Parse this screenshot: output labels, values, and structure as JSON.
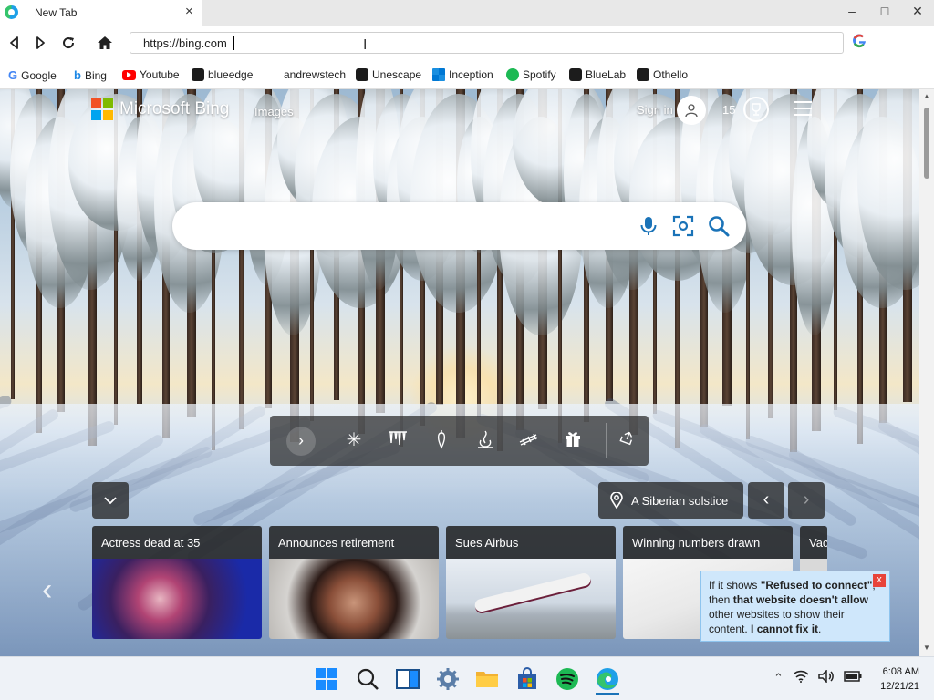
{
  "browser": {
    "tab_title": "New Tab",
    "address_url": "https://bing.com",
    "bookmarks": [
      {
        "label": "Google",
        "icon": "google-icon",
        "color": "#4285f4"
      },
      {
        "label": "Bing",
        "icon": "bing-icon",
        "color": "#1e88e5"
      },
      {
        "label": "Youtube",
        "icon": "youtube-icon",
        "color": "#ff0000"
      },
      {
        "label": "blueedge",
        "icon": "react-icon",
        "color": "#1c1c1c"
      },
      {
        "label": "andrewstech",
        "icon": "",
        "color": ""
      },
      {
        "label": "Unescape",
        "icon": "react-icon",
        "color": "#1c1c1c"
      },
      {
        "label": "Inception",
        "icon": "windows-icon",
        "color": "#0078d4"
      },
      {
        "label": "Spotify",
        "icon": "spotify-icon",
        "color": "#1db954"
      },
      {
        "label": "BlueLab",
        "icon": "react-icon",
        "color": "#1c1c1c"
      },
      {
        "label": "Othello",
        "icon": "react-icon",
        "color": "#1c1c1c"
      }
    ]
  },
  "bing": {
    "logo_text": "Microsoft Bing",
    "nav_images": "Images",
    "sign_in": "Sign in",
    "points": "15",
    "caption": "A Siberian solstice",
    "news": [
      {
        "title": "Actress dead at 35"
      },
      {
        "title": "Announces retirement"
      },
      {
        "title": "Sues Airbus"
      },
      {
        "title": "Winning numbers drawn"
      },
      {
        "title": "Vac"
      }
    ]
  },
  "tooltip": {
    "line1_prefix": "If it shows ",
    "line1_bold": "\"Refused to connect\"",
    "line1_suffix": ",",
    "line2_prefix": "then ",
    "line2_bold": "that website doesn't allow",
    "line3": "other websites to show their",
    "line4_prefix": "content. ",
    "line4_bold": "I cannot fix it",
    "line4_suffix": ".",
    "close": "x"
  },
  "taskbar": {
    "time": "6:08 AM",
    "date": "12/21/21"
  },
  "colors": {
    "ms_red": "#f25022",
    "ms_green": "#7fba00",
    "ms_blue": "#00a4ef",
    "ms_yellow": "#ffb900",
    "bing_blue": "#1a73b8"
  }
}
